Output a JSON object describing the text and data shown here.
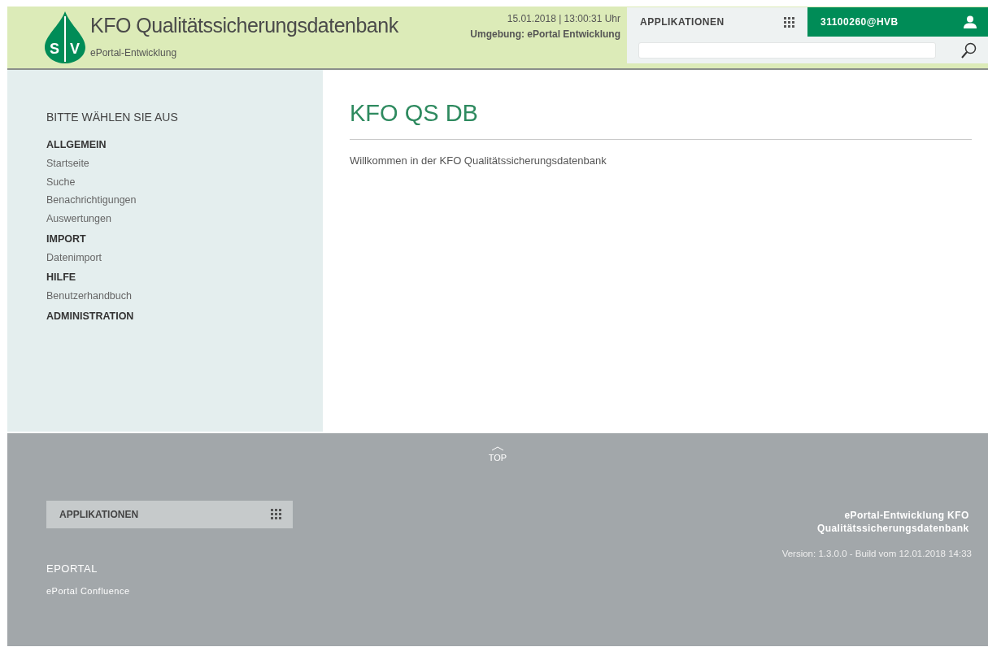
{
  "header": {
    "logo": {
      "letters": [
        "S",
        "V"
      ]
    },
    "title": "KFO Qualitätssicherungsdatenbank",
    "subtitle": "ePortal-Entwicklung",
    "datetime": "15.01.2018 | 13:00:31 Uhr",
    "environment": "Umgebung: ePortal Entwicklung",
    "apps_button": "APPLIKATIONEN",
    "user_button": "31100260@HVB"
  },
  "sidebar": {
    "title": "BITTE WÄHLEN SIE AUS",
    "items": [
      {
        "kind": "heading",
        "label": "ALLGEMEIN"
      },
      {
        "kind": "link",
        "label": "Startseite"
      },
      {
        "kind": "link",
        "label": "Suche"
      },
      {
        "kind": "link",
        "label": "Benachrichtigungen"
      },
      {
        "kind": "link",
        "label": "Auswertungen"
      },
      {
        "kind": "heading",
        "label": "IMPORT"
      },
      {
        "kind": "link",
        "label": "Datenimport"
      },
      {
        "kind": "heading",
        "label": "HILFE"
      },
      {
        "kind": "link",
        "label": "Benutzerhandbuch"
      },
      {
        "kind": "heading",
        "label": "ADMINISTRATION"
      }
    ]
  },
  "main": {
    "heading": "KFO QS DB",
    "text": "Willkommen in der KFO Qualitätssicherungsdatenbank"
  },
  "footer": {
    "top_link": "TOP",
    "apps_button": "APPLIKATIONEN",
    "section": "EPORTAL",
    "links": [
      "ePortal Confluence"
    ],
    "product": "ePortal-Entwicklung KFO Qualitätssicherungsdatenbank",
    "version": "Version: 1.3.0.0 - Build vom 12.01.2018 14:33"
  }
}
